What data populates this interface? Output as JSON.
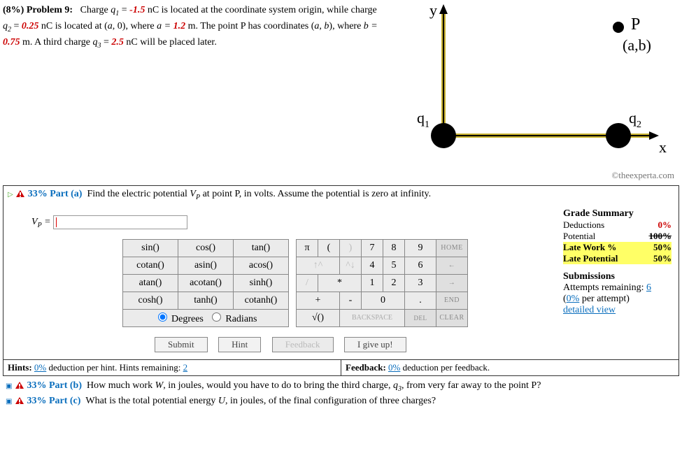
{
  "problem": {
    "weight_label": "(8%)",
    "label": "Problem 9:",
    "q1_label": "q",
    "q1_sub": "1",
    "q1_val": "-1.5",
    "q1_unit_tail": " nC is located at the coordinate system origin, while charge ",
    "q2_label": "q",
    "q2_sub": "2",
    "q2_val": "0.25",
    "q2_unit_tail": " nC is located at (",
    "a_label": "a",
    "a_post": ", 0), where ",
    "a_eq": "a = ",
    "a_val": "1.2",
    "a_unit": " m. The point P has coordinates (",
    "ab": "a, b",
    "ab_post": "), where ",
    "b_eq": "b = ",
    "b_val": "0.75",
    "b_unit": " m. A third charge ",
    "q3_label": "q",
    "q3_sub": "3",
    "q3_val": "2.5",
    "q3_tail": " nC will be placed later."
  },
  "diagram": {
    "y": "y",
    "x": "x",
    "P": "P",
    "ab": "(a,b)",
    "q1": "q",
    "q1s": "1",
    "q2": "q",
    "q2s": "2"
  },
  "attribution": "©theexperta.com",
  "partA": {
    "pct": "33%",
    "label": "Part (a)",
    "text": "Find the electric potential ",
    "vp": "V",
    "vp_sub": "P",
    "text2": " at point P, in volts. Assume the potential is zero at infinity.",
    "eq_label": "V",
    "eq_sub": "P",
    "eq_post": " = "
  },
  "calc": {
    "r1": [
      "sin()",
      "cos()",
      "tan()"
    ],
    "r2": [
      "cotan()",
      "asin()",
      "acos()"
    ],
    "r3": [
      "atan()",
      "acotan()",
      "sinh()"
    ],
    "r4": [
      "cosh()",
      "tanh()",
      "cotanh()"
    ],
    "deg": "Degrees",
    "rad": "Radians"
  },
  "keys": {
    "pi": "π",
    "lp": "(",
    "rp": ")",
    "n7": "7",
    "n8": "8",
    "n9": "9",
    "home": "HOME",
    "up": "↑^",
    "caret": "^↓",
    "n4": "4",
    "n5": "5",
    "n6": "6",
    "left": "←",
    "slash": "/",
    "star": "*",
    "n1": "1",
    "n2": "2",
    "n3": "3",
    "right": "→",
    "plus": "+",
    "minus": "-",
    "n0": "0",
    "dot": ".",
    "end": "END",
    "sqrt": "√()",
    "bksp": "BACKSPACE",
    "del": "DEL",
    "clear": "CLEAR"
  },
  "buttons": {
    "submit": "Submit",
    "hint": "Hint",
    "feedback": "Feedback",
    "giveup": "I give up!"
  },
  "summary": {
    "title": "Grade Summary",
    "ded_l": "Deductions",
    "ded_v": "0%",
    "pot_l": "Potential",
    "pot_v": "100%",
    "late_l": "Late Work %",
    "late_v": "50%",
    "latep_l": "Late Potential",
    "latep_v": "50%"
  },
  "submissions": {
    "title": "Submissions",
    "attempts_l": "Attempts remaining: ",
    "attempts_v": "6",
    "per_l": "(",
    "per_v": "0%",
    "per_post": " per attempt)",
    "detail": "detailed view"
  },
  "hints": {
    "label": "Hints:",
    "pct": "0%",
    "tail": " deduction per hint. Hints remaining: ",
    "remain": "2"
  },
  "fb": {
    "label": "Feedback:",
    "pct": "0%",
    "tail": " deduction per feedback."
  },
  "partB": {
    "pct": "33%",
    "label": "Part (b)",
    "text1": "How much work ",
    "W": "W",
    "text2": ", in joules, would you have to do to bring the third charge, ",
    "q3": "q",
    "q3s": "3",
    "text3": ", from very far away to the point P?"
  },
  "partC": {
    "pct": "33%",
    "label": "Part (c)",
    "text1": "What is the total potential energy ",
    "U": "U",
    "text2": ", in joules, of the final configuration of three charges?"
  }
}
